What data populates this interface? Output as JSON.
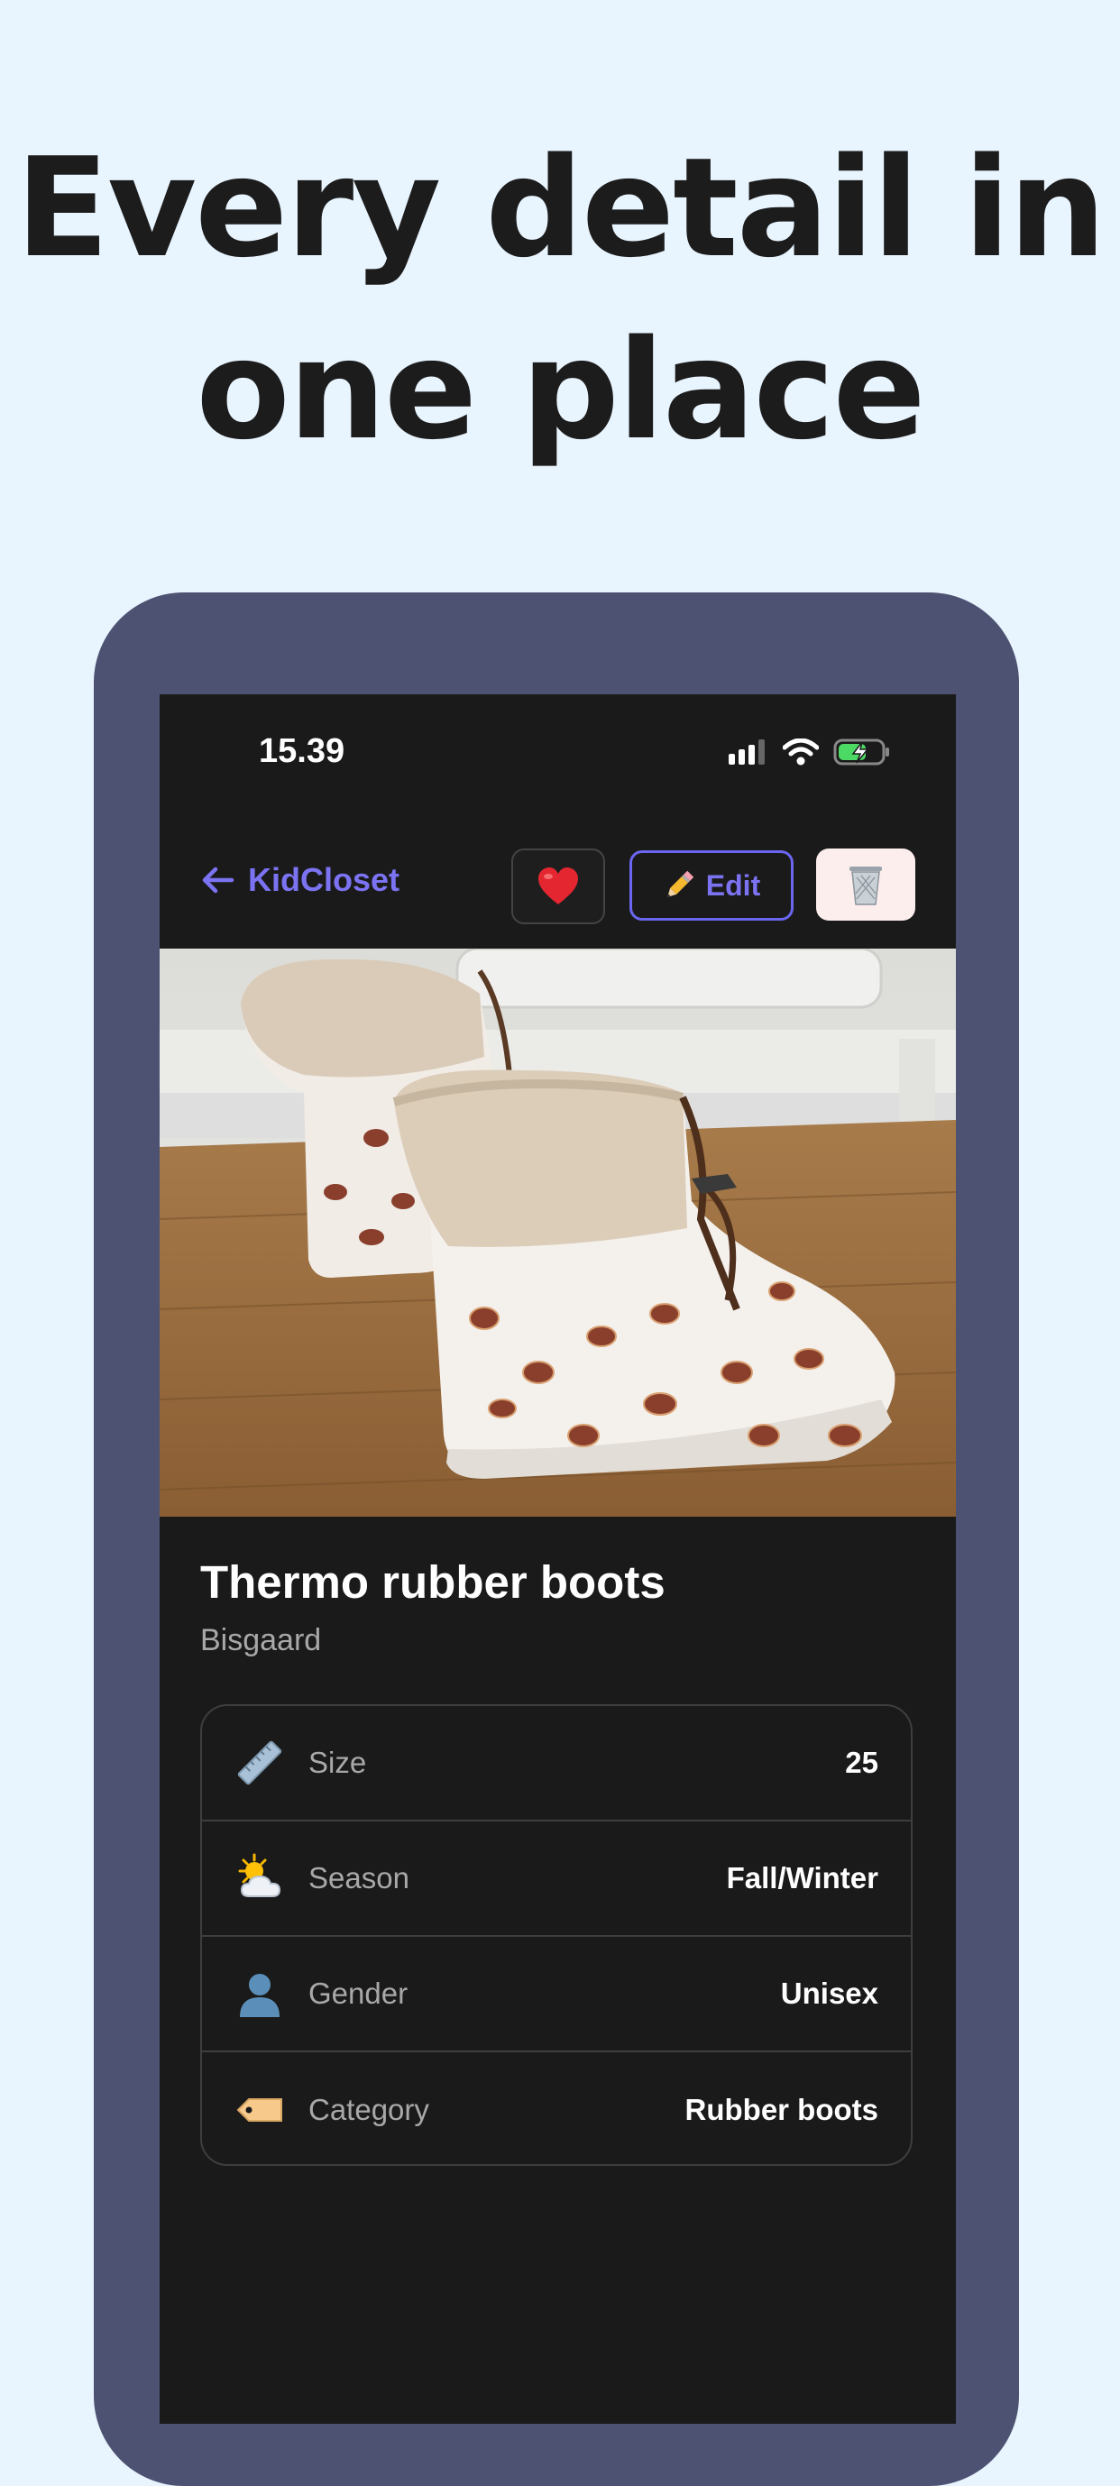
{
  "headline": {
    "line1": "Every detail in",
    "line2": "one place"
  },
  "status_bar": {
    "time": "15.39",
    "icons": [
      "cellular-signal-icon",
      "wifi-icon",
      "battery-charging-icon"
    ]
  },
  "navbar": {
    "back_label": "KidCloset",
    "back_icon": "arrow-left-icon",
    "favorite_icon": "red-heart-icon",
    "edit_label": "Edit",
    "edit_icon": "pencil-icon",
    "delete_icon": "trash-can-icon"
  },
  "item": {
    "title": "Thermo rubber boots",
    "brand": "Bisgaard",
    "photo": "children's white rubber boots with dachshund print on wooden floor",
    "details": [
      {
        "icon": "ruler-icon",
        "label": "Size",
        "value": "25"
      },
      {
        "icon": "sun-behind-cloud-icon",
        "label": "Season",
        "value": "Fall/Winter"
      },
      {
        "icon": "person-silhouette-icon",
        "label": "Gender",
        "value": "Unisex"
      },
      {
        "icon": "price-tag-icon",
        "label": "Category",
        "value": "Rubber boots"
      }
    ]
  },
  "colors": {
    "background": "#e8f4fe",
    "device_frame": "#4d5273",
    "screen": "#1a1a1a",
    "accent": "#7b73f2",
    "delete_bg": "#fdeeee"
  }
}
